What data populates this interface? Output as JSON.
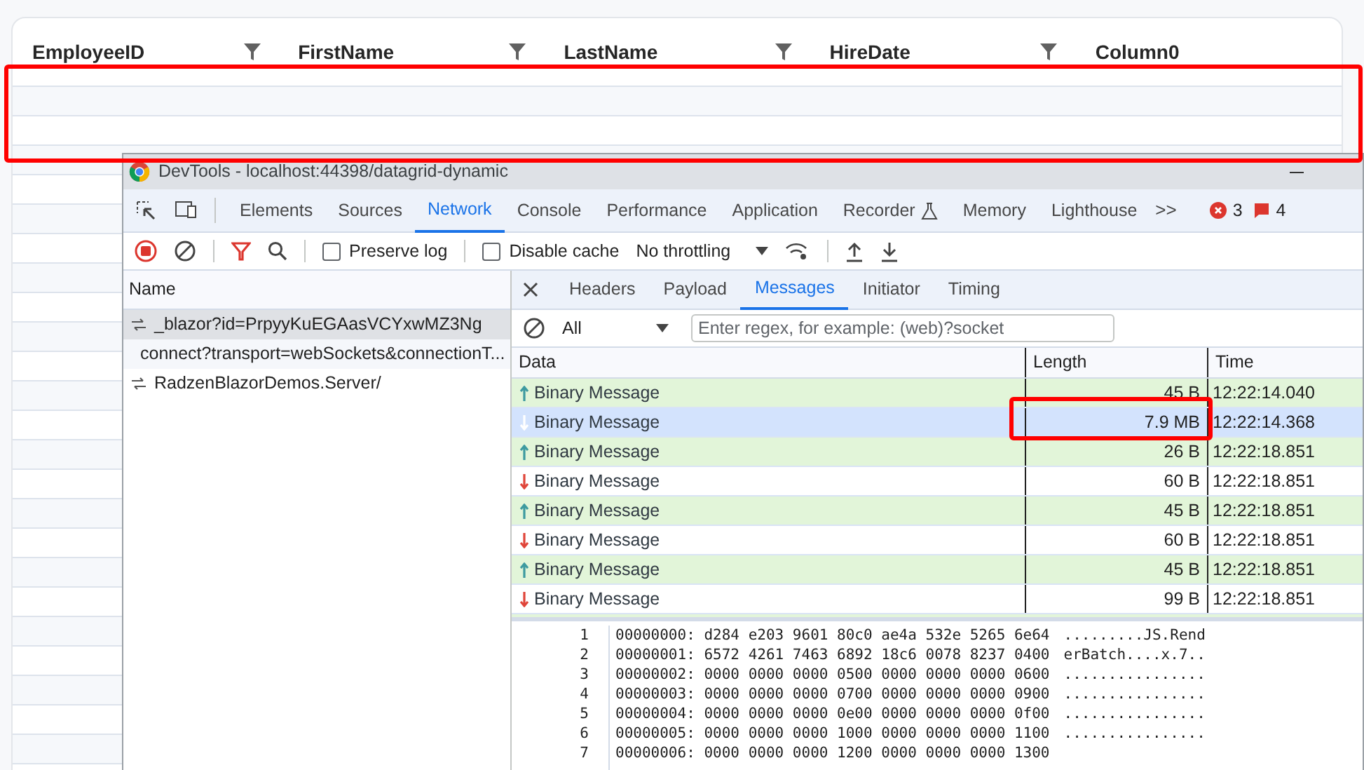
{
  "grid": {
    "columns": [
      {
        "label": "EmployeeID",
        "filter": true
      },
      {
        "label": "FirstName",
        "filter": true
      },
      {
        "label": "LastName",
        "filter": true
      },
      {
        "label": "HireDate",
        "filter": true
      },
      {
        "label": "Column0",
        "filter": false
      }
    ]
  },
  "devtools": {
    "title": "DevTools - localhost:44398/datagrid-dynamic",
    "tabs": [
      {
        "label": "Elements",
        "selected": false
      },
      {
        "label": "Sources",
        "selected": false
      },
      {
        "label": "Network",
        "selected": true
      },
      {
        "label": "Console",
        "selected": false
      },
      {
        "label": "Performance",
        "selected": false
      },
      {
        "label": "Application",
        "selected": false
      },
      {
        "label": "Recorder",
        "selected": false
      },
      {
        "label": "Memory",
        "selected": false
      },
      {
        "label": "Lighthouse",
        "selected": false
      }
    ],
    "more": ">>",
    "errors": "3",
    "issues": "4",
    "toolbar": {
      "preserve_log": {
        "label": "Preserve log",
        "checked": false
      },
      "disable_cache": {
        "label": "Disable cache",
        "checked": false
      },
      "throttling": "No throttling"
    },
    "requests": {
      "header": "Name",
      "items": [
        {
          "name": "_blazor?id=PrpyyKuEGAasVCYxwMZ3Ng",
          "selected": true
        },
        {
          "name": "connect?transport=webSockets&connectionT...",
          "selected": false
        },
        {
          "name": "RadzenBlazorDemos.Server/",
          "selected": false
        }
      ]
    },
    "detail_tabs": [
      {
        "label": "Headers",
        "selected": false
      },
      {
        "label": "Payload",
        "selected": false
      },
      {
        "label": "Messages",
        "selected": true
      },
      {
        "label": "Initiator",
        "selected": false
      },
      {
        "label": "Timing",
        "selected": false
      }
    ],
    "message_filter": {
      "value": "All",
      "placeholder": "Enter regex, for example: (web)?socket"
    },
    "messages": {
      "columns": [
        "Data",
        "Length",
        "Time"
      ],
      "rows": [
        {
          "data": "Binary Message",
          "length": "45 B",
          "time": "12:22:14.040",
          "kind": "sent",
          "selected": false
        },
        {
          "data": "Binary Message",
          "length": "7.9 MB",
          "time": "12:22:14.368",
          "kind": "received",
          "selected": true
        },
        {
          "data": "Binary Message",
          "length": "26 B",
          "time": "12:22:18.851",
          "kind": "sent",
          "selected": false
        },
        {
          "data": "Binary Message",
          "length": "60 B",
          "time": "12:22:18.851",
          "kind": "received",
          "selected": false
        },
        {
          "data": "Binary Message",
          "length": "45 B",
          "time": "12:22:18.851",
          "kind": "sent",
          "selected": false
        },
        {
          "data": "Binary Message",
          "length": "60 B",
          "time": "12:22:18.851",
          "kind": "received",
          "selected": false
        },
        {
          "data": "Binary Message",
          "length": "45 B",
          "time": "12:22:18.851",
          "kind": "sent",
          "selected": false
        },
        {
          "data": "Binary Message",
          "length": "99 B",
          "time": "12:22:18.851",
          "kind": "received",
          "selected": false
        }
      ]
    },
    "hex_lines": [
      {
        "number": "1",
        "hex": "00000000: d284 e203 9601 80c0 ae4a 532e 5265 6e64",
        "text": ".........JS.Rend"
      },
      {
        "number": "2",
        "hex": "00000001: 6572 4261 7463 6892 18c6 0078 8237 0400",
        "text": "erBatch....x.7.."
      },
      {
        "number": "3",
        "hex": "00000002: 0000 0000 0000 0500 0000 0000 0000 0600",
        "text": "................"
      },
      {
        "number": "4",
        "hex": "00000003: 0000 0000 0000 0700 0000 0000 0000 0900",
        "text": "................"
      },
      {
        "number": "5",
        "hex": "00000004: 0000 0000 0000 0e00 0000 0000 0000 0f00",
        "text": "................"
      },
      {
        "number": "6",
        "hex": "00000005: 0000 0000 0000 1000 0000 0000 0000 1100",
        "text": "................"
      },
      {
        "number": "7",
        "hex": "00000006: 0000 0000 0000 1200 0000 0000 0000 1300"
      }
    ]
  }
}
